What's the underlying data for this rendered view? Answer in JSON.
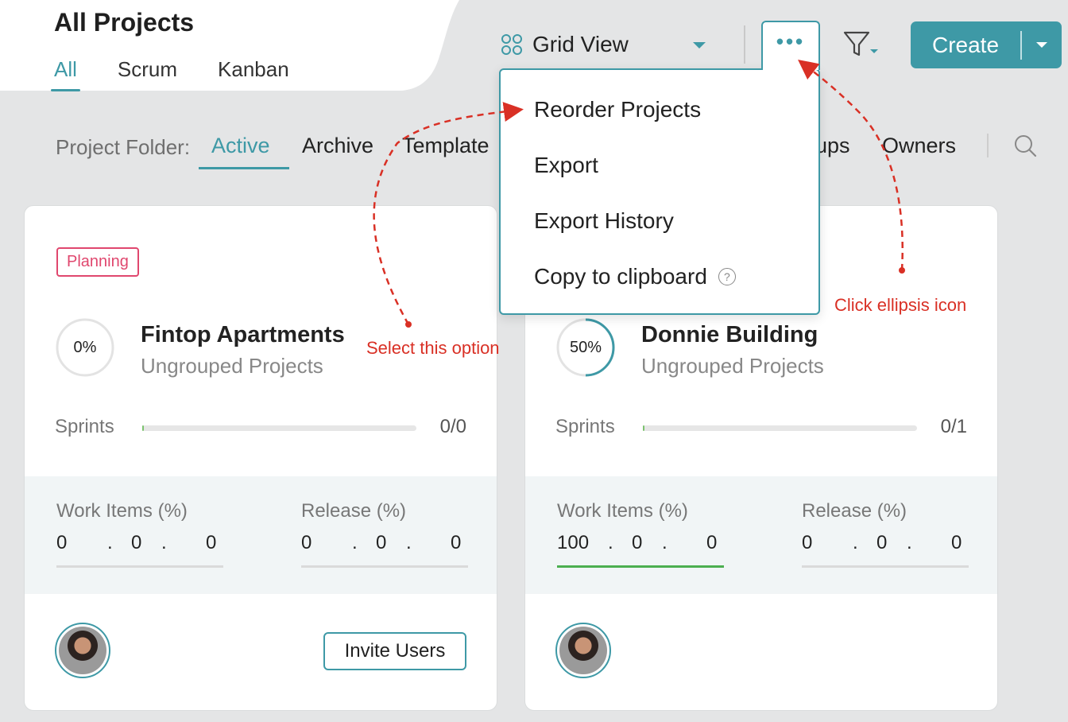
{
  "header": {
    "title": "All Projects",
    "tabs": [
      {
        "label": "All",
        "active": true
      },
      {
        "label": "Scrum",
        "active": false
      },
      {
        "label": "Kanban",
        "active": false
      }
    ]
  },
  "toolbar": {
    "view_label": "Grid View",
    "view_icon": "grid-icon",
    "more_icon": "ellipsis-icon",
    "more_label": "•••",
    "filter_icon": "filter-icon",
    "create_label": "Create",
    "accent_color": "#3e99a6"
  },
  "folder_bar": {
    "label": "Project Folder:",
    "items": [
      "Active",
      "Archive",
      "Template",
      "ups",
      "Owners"
    ],
    "active": "Active"
  },
  "menu": {
    "items": [
      {
        "label": "Reorder Projects"
      },
      {
        "label": "Export"
      },
      {
        "label": "Export History"
      },
      {
        "label": "Copy to clipboard",
        "help": "?"
      }
    ]
  },
  "cards": [
    {
      "badge": "Planning",
      "progress": 0,
      "progress_label": "0%",
      "name": "Fintop Apartments",
      "group": "Ungrouped Projects",
      "sprints_label": "Sprints",
      "sprints_value": "0/0",
      "sprints_fill": 0,
      "work_items_label": "Work Items (%)",
      "work_items_values": [
        "0",
        ".",
        "0",
        ".",
        "0"
      ],
      "release_label": "Release (%)",
      "release_values": [
        "0",
        ".",
        "0",
        ".",
        "0"
      ],
      "invite_label": "Invite Users"
    },
    {
      "progress": 50,
      "progress_label": "50%",
      "name": "Donnie Building",
      "group": "Ungrouped Projects",
      "sprints_label": "Sprints",
      "sprints_value": "0/1",
      "sprints_fill": 0,
      "work_items_label": "Work Items (%)",
      "work_items_values": [
        "100",
        ".",
        "0",
        ".",
        "0"
      ],
      "release_label": "Release (%)",
      "release_values": [
        "0",
        ".",
        "0",
        ".",
        "0"
      ]
    }
  ],
  "annotations": {
    "select_option": "Select this option",
    "click_ellipsis": "Click ellipsis icon",
    "color": "#d93025"
  }
}
